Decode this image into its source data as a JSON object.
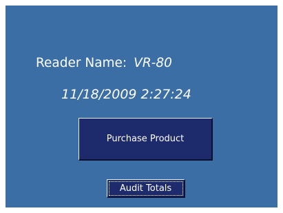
{
  "reader": {
    "label": "Reader Name:",
    "value": "VR-80"
  },
  "datetime": "11/18/2009 2:27:24",
  "buttons": {
    "purchase_label": "Purchase Product",
    "audit_label": "Audit Totals"
  },
  "colors": {
    "background": "#3a6ea5",
    "button_face": "#1d2a6b",
    "text": "#ffffff"
  }
}
